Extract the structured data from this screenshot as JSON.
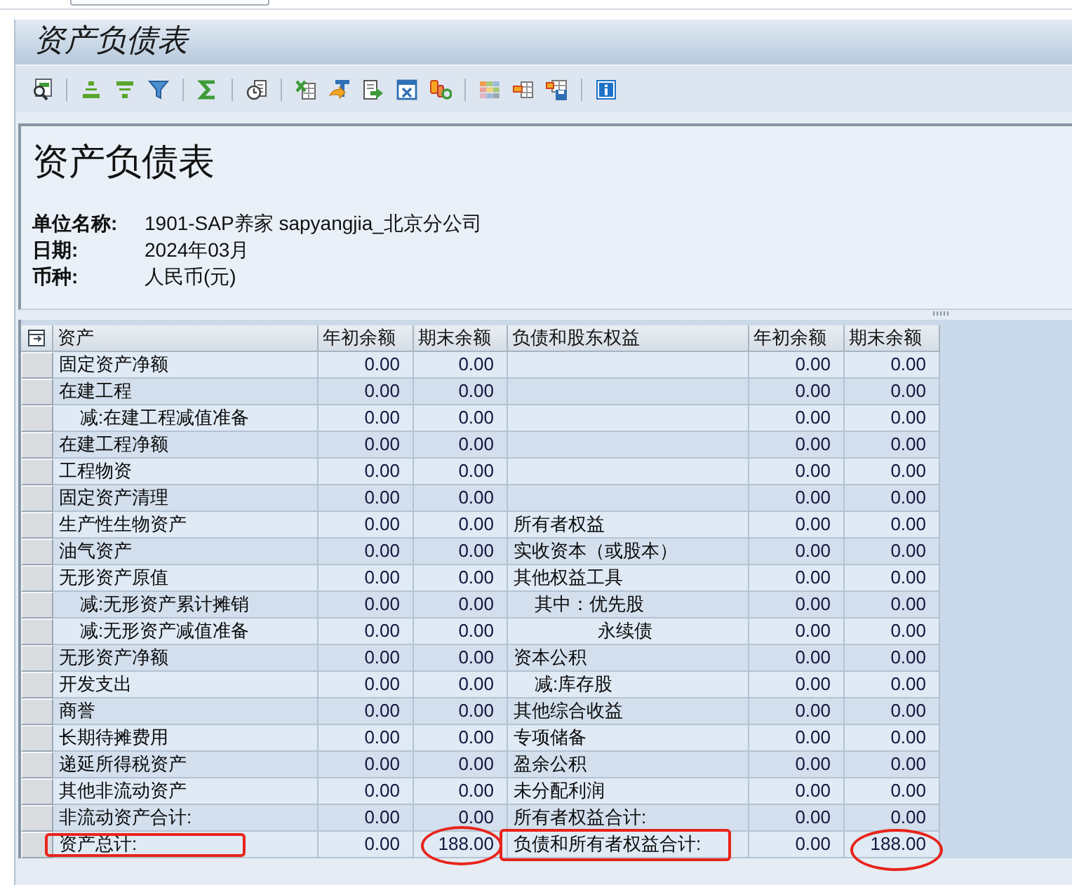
{
  "window": {
    "title": "资产负债表"
  },
  "report": {
    "title": "资产负债表",
    "fields": [
      {
        "label": "单位名称:",
        "value": "1901-SAP养家 sapyangjia_北京分公司"
      },
      {
        "label": "日期:",
        "value": "2024年03月"
      },
      {
        "label": "币种:",
        "value": "人民币(元)"
      }
    ]
  },
  "table": {
    "columns": [
      "资产",
      "年初余额",
      "期末余额",
      "负债和股东权益",
      "年初余额",
      "期末余额"
    ],
    "rows": [
      {
        "selected": false,
        "asset": "固定资产净额",
        "asset_begin": "0.00",
        "asset_end": "0.00",
        "liability_begin": "0.00",
        "liability_end": "0.00"
      },
      {
        "selected": false,
        "asset": "在建工程",
        "asset_begin": "0.00",
        "asset_end": "0.00",
        "liability_begin": "0.00",
        "liability_end": "0.00"
      },
      {
        "selected": false,
        "asset": "  减:在建工程减值准备",
        "asset_begin": "0.00",
        "asset_end": "0.00",
        "liability_begin": "0.00",
        "liability_end": "0.00"
      },
      {
        "selected": false,
        "asset": "在建工程净额",
        "asset_begin": "0.00",
        "asset_end": "0.00",
        "liability_begin": "0.00",
        "liability_end": "0.00"
      },
      {
        "selected": false,
        "asset": "工程物资",
        "asset_begin": "0.00",
        "asset_end": "0.00",
        "liability_begin": "0.00",
        "liability_end": "0.00"
      },
      {
        "selected": false,
        "asset": "固定资产清理",
        "asset_begin": "0.00",
        "asset_end": "0.00",
        "liability_begin": "0.00",
        "liability_end": "0.00"
      },
      {
        "selected": false,
        "asset": "生产性生物资产",
        "asset_begin": "0.00",
        "asset_end": "0.00",
        "liability": "所有者权益",
        "liability_begin": "0.00",
        "liability_end": "0.00"
      },
      {
        "selected": false,
        "asset": "油气资产",
        "asset_begin": "0.00",
        "asset_end": "0.00",
        "liability": "实收资本（或股本）",
        "liability_begin": "0.00",
        "liability_end": "0.00"
      },
      {
        "selected": false,
        "asset": "无形资产原值",
        "asset_begin": "0.00",
        "asset_end": "0.00",
        "liability": "其他权益工具",
        "liability_begin": "0.00",
        "liability_end": "0.00"
      },
      {
        "selected": false,
        "asset": "  减:无形资产累计摊销",
        "asset_begin": "0.00",
        "asset_end": "0.00",
        "liability": "  其中：优先股",
        "liability_begin": "0.00",
        "liability_end": "0.00"
      },
      {
        "selected": false,
        "asset": "  减:无形资产减值准备",
        "asset_begin": "0.00",
        "asset_end": "0.00",
        "liability": "        永续债",
        "liability_begin": "0.00",
        "liability_end": "0.00"
      },
      {
        "selected": false,
        "asset": "无形资产净额",
        "asset_begin": "0.00",
        "asset_end": "0.00",
        "liability": "资本公积",
        "liability_begin": "0.00",
        "liability_end": "0.00"
      },
      {
        "selected": false,
        "asset": "开发支出",
        "asset_begin": "0.00",
        "asset_end": "0.00",
        "liability": "  减:库存股",
        "liability_begin": "0.00",
        "liability_end": "0.00"
      },
      {
        "selected": false,
        "asset": "商誉",
        "asset_begin": "0.00",
        "asset_end": "0.00",
        "liability": "其他综合收益",
        "liability_begin": "0.00",
        "liability_end": "0.00"
      },
      {
        "selected": false,
        "asset": "长期待摊费用",
        "asset_begin": "0.00",
        "asset_end": "0.00",
        "liability": "专项储备",
        "liability_begin": "0.00",
        "liability_end": "0.00"
      },
      {
        "selected": false,
        "asset": "递延所得税资产",
        "asset_begin": "0.00",
        "asset_end": "0.00",
        "liability": "盈余公积",
        "liability_begin": "0.00",
        "liability_end": "0.00"
      },
      {
        "selected": false,
        "asset": "其他非流动资产",
        "asset_begin": "0.00",
        "asset_end": "0.00",
        "liability": "未分配利润",
        "liability_begin": "0.00",
        "liability_end": "0.00"
      },
      {
        "selected": false,
        "asset": "非流动资产合计:",
        "asset_begin": "0.00",
        "asset_end": "0.00",
        "liability": "所有者权益合计:",
        "liability_begin": "0.00",
        "liability_end": "0.00"
      },
      {
        "selected": false,
        "asset": "资产总计:",
        "asset_begin": "0.00",
        "asset_end": "188.00",
        "liability": "负债和所有者权益合计:",
        "liability_begin": "0.00",
        "liability_end": "188.00",
        "annotations": {
          "asset": {
            "kind": "rectangle"
          },
          "asset_end": {
            "kind": "ellipse"
          },
          "liability": {
            "kind": "rectangle"
          },
          "liability_end": {
            "kind": "ellipse"
          }
        }
      }
    ]
  }
}
